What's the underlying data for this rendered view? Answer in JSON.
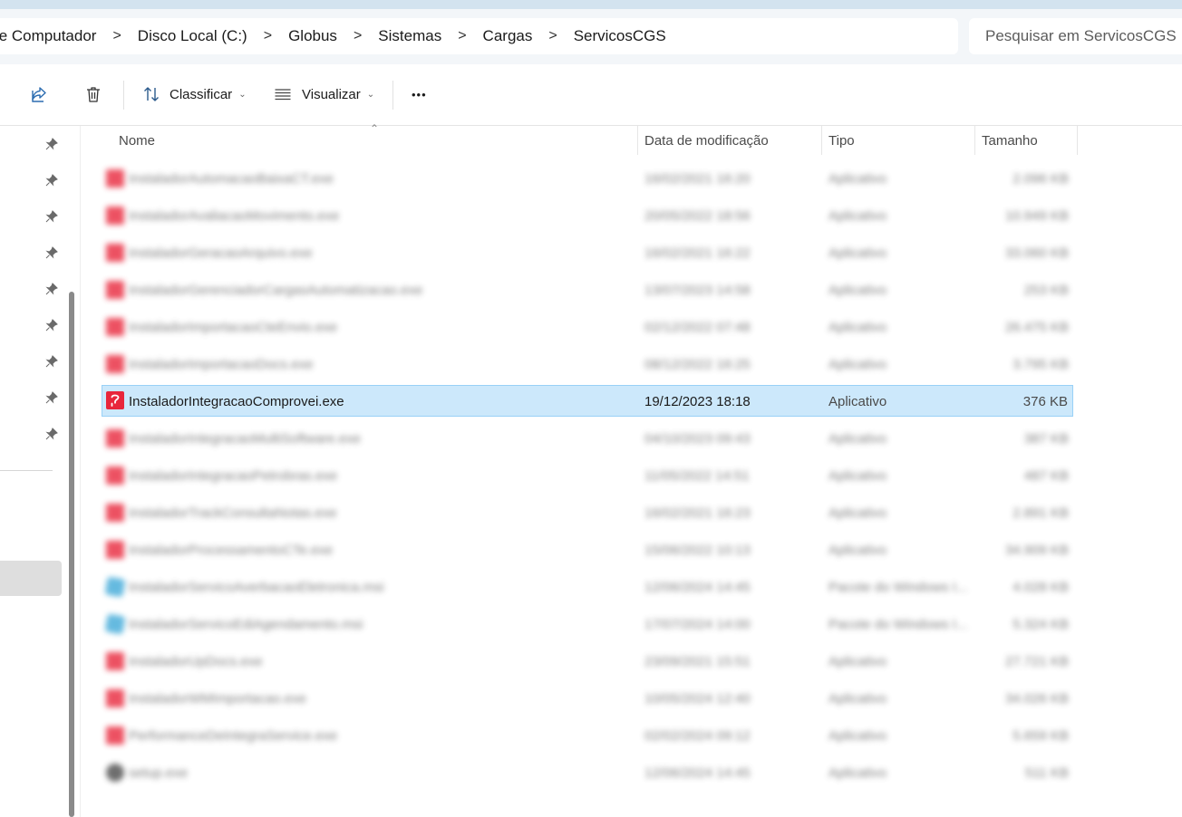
{
  "address_bar": {
    "crumbs": [
      "te Computador",
      "Disco Local (C:)",
      "Globus",
      "Sistemas",
      "Cargas",
      "ServicosCGS"
    ],
    "separator": ">"
  },
  "search": {
    "placeholder": "Pesquisar em ServicosCGS"
  },
  "toolbar": {
    "share_icon": "share-icon",
    "delete_icon": "trash-icon",
    "sort_label": "Classificar",
    "view_label": "Visualizar",
    "more_label": "•••"
  },
  "columns": {
    "name": "Nome",
    "date": "Data de modificação",
    "type": "Tipo",
    "size": "Tamanho"
  },
  "files": [
    {
      "name": "InstaladorAutomacaoBaixaCT.exe",
      "date": "16/02/2021 16:20",
      "type": "Aplicativo",
      "size": "2.096 KB",
      "icon": "app",
      "blurred": true
    },
    {
      "name": "InstaladorAvaliacaoMovimento.exe",
      "date": "20/05/2022 18:56",
      "type": "Aplicativo",
      "size": "10.949 KB",
      "icon": "app",
      "blurred": true
    },
    {
      "name": "InstaladorGeracaoArquivo.exe",
      "date": "16/02/2021 16:22",
      "type": "Aplicativo",
      "size": "33.060 KB",
      "icon": "app",
      "blurred": true
    },
    {
      "name": "InstaladorGerenciadorCargasAutomatizacao.exe",
      "date": "13/07/2023 14:58",
      "type": "Aplicativo",
      "size": "253 KB",
      "icon": "app",
      "blurred": true
    },
    {
      "name": "InstaladorImportacaoCteEnvio.exe",
      "date": "02/12/2022 07:48",
      "type": "Aplicativo",
      "size": "26.475 KB",
      "icon": "app",
      "blurred": true
    },
    {
      "name": "InstaladorImportacaoDocs.exe",
      "date": "08/12/2022 16:25",
      "type": "Aplicativo",
      "size": "3.795 KB",
      "icon": "app",
      "blurred": true
    },
    {
      "name": "InstaladorIntegracaoComprovei.exe",
      "date": "19/12/2023 18:18",
      "type": "Aplicativo",
      "size": "376 KB",
      "icon": "app",
      "blurred": false,
      "selected": true
    },
    {
      "name": "InstaladorIntegracaoMultiSoftware.exe",
      "date": "04/10/2023 09:43",
      "type": "Aplicativo",
      "size": "387 KB",
      "icon": "app",
      "blurred": true
    },
    {
      "name": "InstaladorIntegracaoPetrobras.exe",
      "date": "11/05/2022 14:51",
      "type": "Aplicativo",
      "size": "487 KB",
      "icon": "app",
      "blurred": true
    },
    {
      "name": "InstaladorTrackConsultaNotas.exe",
      "date": "16/02/2021 16:23",
      "type": "Aplicativo",
      "size": "2.891 KB",
      "icon": "app",
      "blurred": true
    },
    {
      "name": "InstaladorProcessamentoCTe.exe",
      "date": "15/06/2022 10:13",
      "type": "Aplicativo",
      "size": "34.909 KB",
      "icon": "app",
      "blurred": true
    },
    {
      "name": "InstaladorServicoAverbacaoEletronica.msi",
      "date": "12/06/2024 14:45",
      "type": "Pacote do Windows I...",
      "size": "4.028 KB",
      "icon": "msi",
      "blurred": true
    },
    {
      "name": "InstaladorServicoEdiAgendamento.msi",
      "date": "17/07/2024 14:00",
      "type": "Pacote do Windows I...",
      "size": "5.324 KB",
      "icon": "msi",
      "blurred": true
    },
    {
      "name": "InstaladorUpDocs.exe",
      "date": "23/09/2021 15:51",
      "type": "Aplicativo",
      "size": "27.721 KB",
      "icon": "app",
      "blurred": true
    },
    {
      "name": "InstaladorWMImportacao.exe",
      "date": "10/05/2024 12:40",
      "type": "Aplicativo",
      "size": "34.026 KB",
      "icon": "app",
      "blurred": true
    },
    {
      "name": "PerformanceDeIntegraService.exe",
      "date": "02/02/2024 09:12",
      "type": "Aplicativo",
      "size": "5.659 KB",
      "icon": "app",
      "blurred": true
    },
    {
      "name": "setup.exe",
      "date": "12/06/2024 14:45",
      "type": "Aplicativo",
      "size": "511 KB",
      "icon": "setup",
      "blurred": true
    }
  ]
}
